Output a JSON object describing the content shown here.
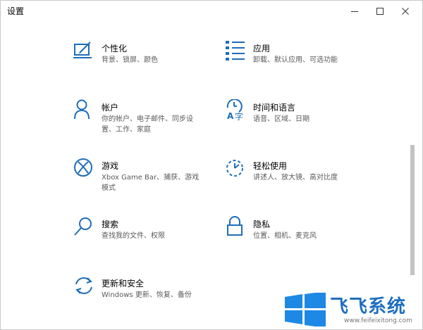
{
  "window": {
    "title": "设置",
    "controls": {
      "minimize_icon": "minimize-icon",
      "maximize_icon": "maximize-icon",
      "close_icon": "close-icon"
    }
  },
  "accent_color": "#1f6db8",
  "settings": [
    {
      "icon": "personalization-icon",
      "label": "个性化",
      "desc": "背景、锁屏、颜色"
    },
    {
      "icon": "apps-icon",
      "label": "应用",
      "desc": "卸载、默认应用、可选功能"
    },
    {
      "icon": "accounts-icon",
      "label": "帐户",
      "desc": "你的帐户、电子邮件、同步设置、工作、家庭"
    },
    {
      "icon": "time-language-icon",
      "label": "时间和语言",
      "desc": "语音、区域、日期"
    },
    {
      "icon": "gaming-icon",
      "label": "游戏",
      "desc": "Xbox Game Bar、捕获、游戏模式"
    },
    {
      "icon": "ease-of-access-icon",
      "label": "轻松使用",
      "desc": "讲述人、放大镜、高对比度"
    },
    {
      "icon": "search-icon",
      "label": "搜索",
      "desc": "查找我的文件、权限"
    },
    {
      "icon": "privacy-icon",
      "label": "隐私",
      "desc": "位置、相机、麦克风"
    },
    {
      "icon": "update-security-icon",
      "label": "更新和安全",
      "desc": "Windows 更新、恢复、备份"
    }
  ],
  "watermark": {
    "text": "飞飞系统",
    "url": "www.feifeixitong.com",
    "icon": "windows-logo-icon"
  }
}
